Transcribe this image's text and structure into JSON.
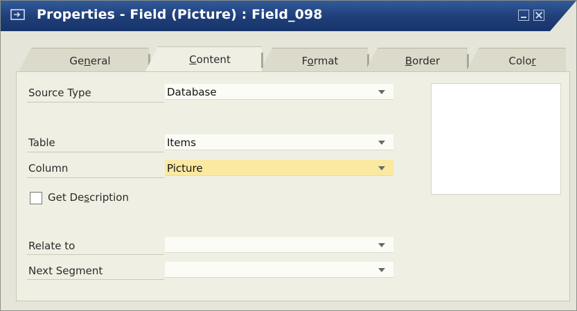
{
  "window": {
    "title": "Properties - Field (Picture) : Field_098",
    "title_icon": "properties-window-icon",
    "controls": [
      "minimize-icon",
      "close-icon"
    ]
  },
  "tabs": [
    {
      "pre": "Ge",
      "ul": "n",
      "post": "eral",
      "active": false
    },
    {
      "pre": "",
      "ul": "C",
      "post": "ontent",
      "active": true
    },
    {
      "pre": "F",
      "ul": "o",
      "post": "rmat",
      "active": false
    },
    {
      "pre": "",
      "ul": "B",
      "post": "order",
      "active": false
    },
    {
      "pre": "Colo",
      "ul": "r",
      "post": "",
      "active": false
    }
  ],
  "fields": {
    "source_type": {
      "label": "Source Type",
      "value": "Database"
    },
    "table": {
      "label": "Table",
      "value": "Items"
    },
    "column": {
      "label": "Column",
      "value": "Picture",
      "highlight_color": "#fbe9a2"
    },
    "get_description": {
      "pre": "Get De",
      "ul": "s",
      "post": "cription",
      "checked": false
    },
    "relate_to": {
      "label": "Relate to",
      "value": ""
    },
    "next_segment": {
      "label": "Next Segment",
      "value": ""
    }
  },
  "colors": {
    "titlebar": "#1f3e78",
    "background": "#e6e5d9",
    "panel": "#efefe4",
    "input": "#fcfcf7"
  }
}
